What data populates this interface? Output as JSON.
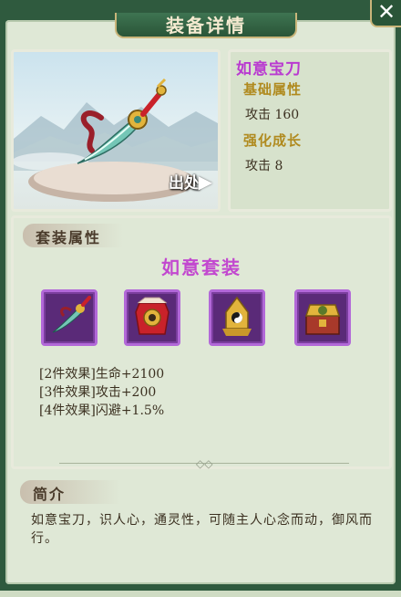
{
  "header": {
    "title": "装备详情",
    "close_label": "✕"
  },
  "item": {
    "name": "如意宝刀",
    "base_title": "基础属性",
    "base_stat": "攻击 160",
    "growth_title": "强化成长",
    "growth_stat": "攻击 8",
    "source_label": "出处"
  },
  "set": {
    "section_label": "套装属性",
    "name": "如意套装",
    "icons": [
      "sword-icon",
      "armor-icon",
      "helmet-icon",
      "treasure-chest-icon"
    ],
    "effects": [
      "[2件效果]生命+2100",
      "[3件效果]攻击+200",
      "[4件效果]闪避+1.5%"
    ]
  },
  "intro": {
    "section_label": "简介",
    "text": "如意宝刀，识人心，通灵性，可随主人心念而动，御风而行。"
  },
  "colors": {
    "accent_purple": "#c248cf",
    "subtitle_gold": "#b08a1e",
    "frame_green": "#2f5a3e"
  }
}
